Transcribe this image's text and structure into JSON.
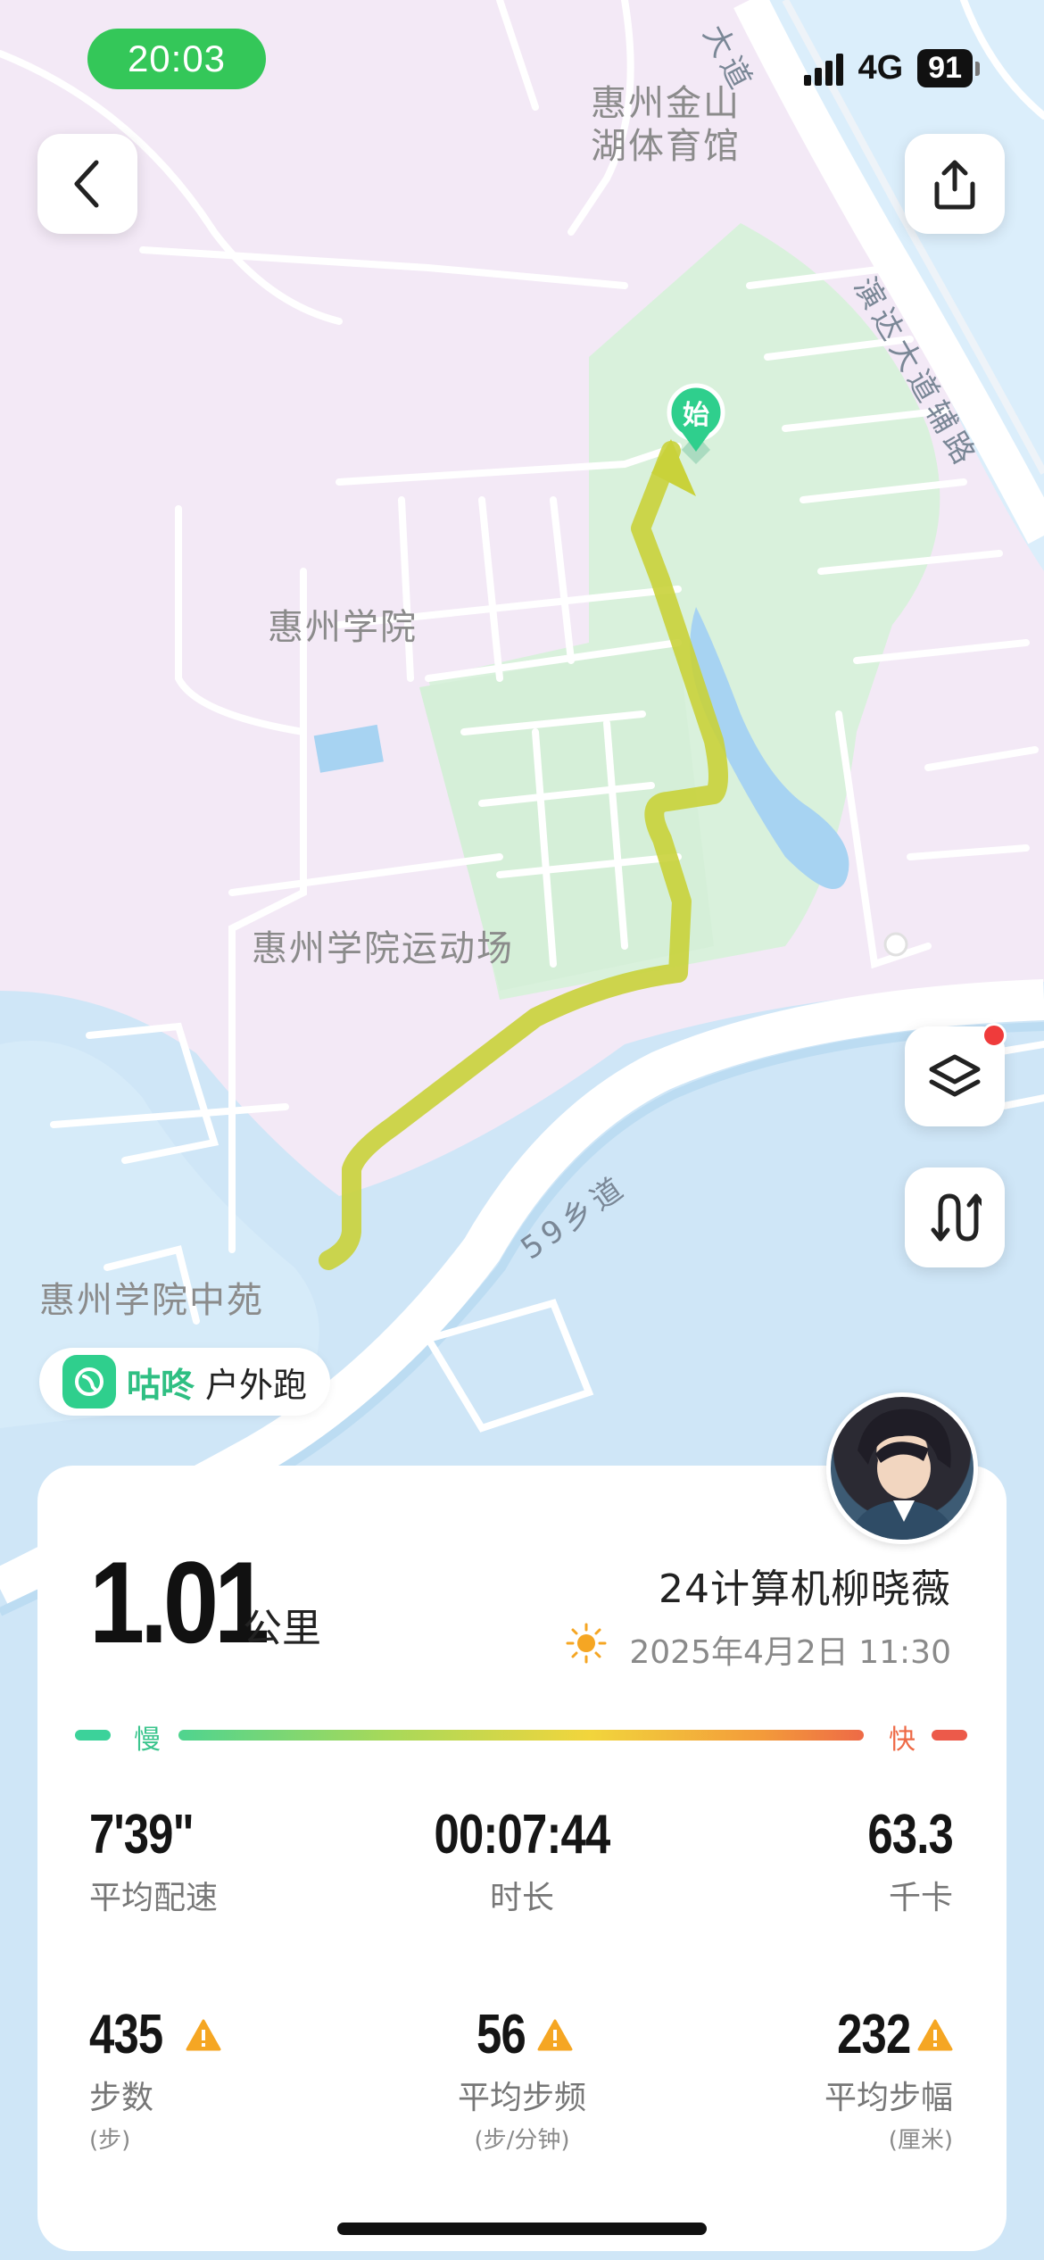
{
  "status_bar": {
    "time": "20:03",
    "network": "4G",
    "battery": "91"
  },
  "map": {
    "labels": {
      "stadium": "惠州金山\n湖体育馆",
      "college": "惠州学院",
      "sports_field": "惠州学院运动场",
      "zhongyuan": "惠州学院中苑",
      "road_top": "大道",
      "road_right": "演达大道辅路",
      "road_bottom": "59乡道"
    },
    "start_marker": "始",
    "colors": {
      "route": "#c9d23a",
      "start": "#2fcf8d",
      "water": "#bfe0f7",
      "park": "#d6f0d8",
      "land": "#f3e9f6"
    }
  },
  "badge": {
    "app_name": "咕咚",
    "activity": "户外跑"
  },
  "summary": {
    "distance": "1.01",
    "distance_unit": "公里",
    "user": "24计算机柳晓薇",
    "datetime": "2025年4月2日 11:30",
    "weather_icon": "sun-icon"
  },
  "pace_legend": {
    "slow": "慢",
    "fast": "快"
  },
  "stats": {
    "pace": {
      "value": "7'39\"",
      "label": "平均配速"
    },
    "duration": {
      "value": "00:07:44",
      "label": "时长"
    },
    "calories": {
      "value": "63.3",
      "label": "千卡"
    },
    "steps": {
      "value": "435",
      "label": "步数",
      "unit": "(步)"
    },
    "cadence": {
      "value": "56",
      "label": "平均步频",
      "unit": "(步/分钟)"
    },
    "stride": {
      "value": "232",
      "label": "平均步幅",
      "unit": "(厘米)"
    }
  },
  "accent": "#2fcf8d"
}
